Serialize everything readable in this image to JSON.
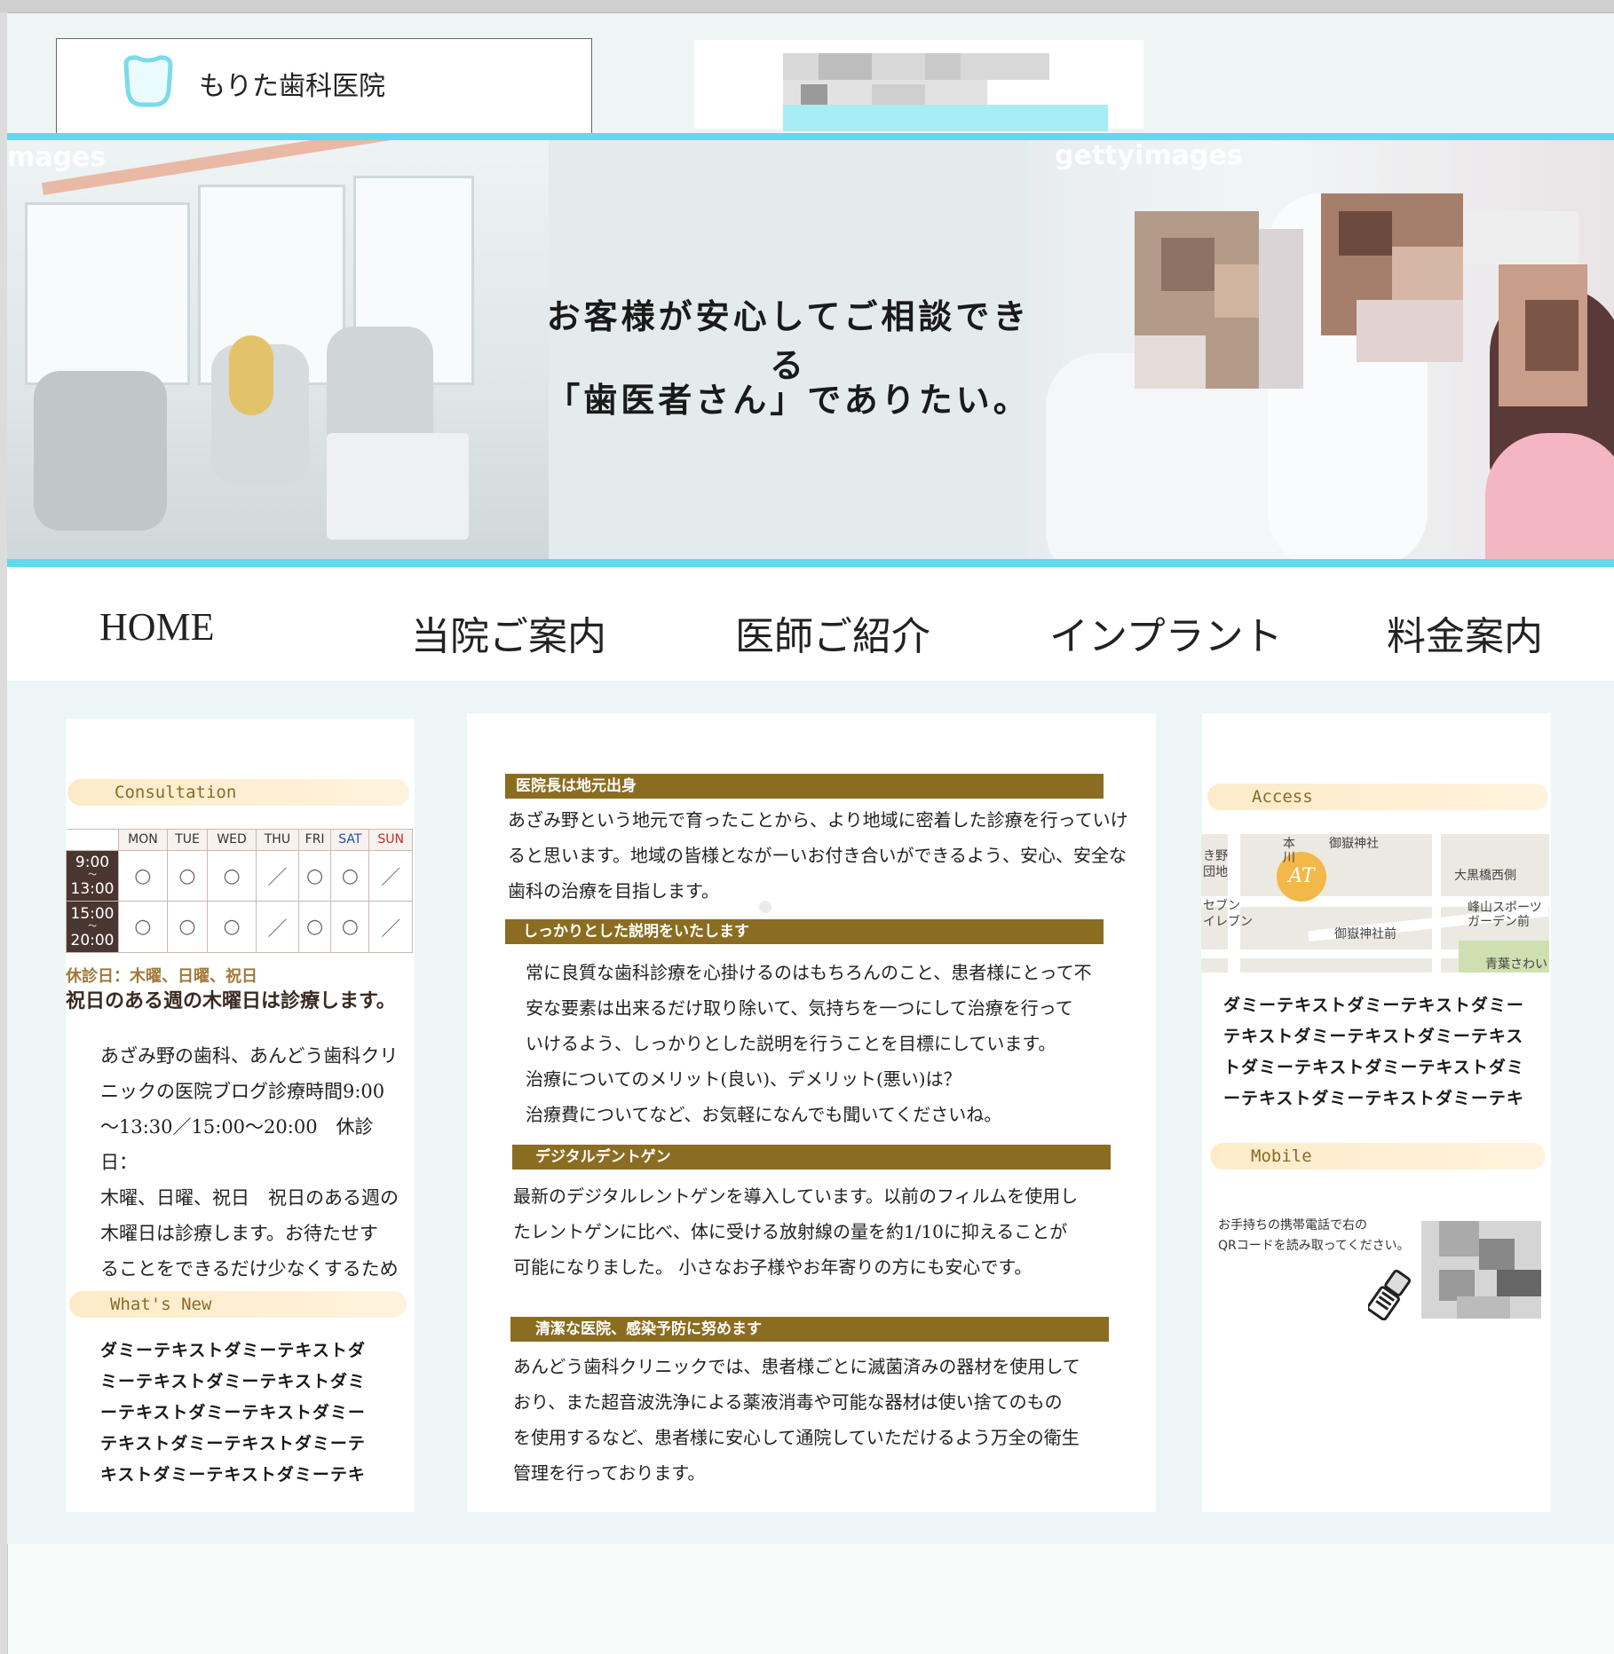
{
  "site": {
    "name": "もりた歯科医院"
  },
  "hero": {
    "line1": "お客様が安心してご相談できる",
    "line2": "「歯医者さん」でありたい。",
    "watermark_left": "mages",
    "watermark_right": "gettyimages"
  },
  "nav": {
    "items": [
      "HOME",
      "当院ご案内",
      "医師ご紹介",
      "インプラント",
      "料金案内"
    ]
  },
  "left": {
    "consultation_label": "Consultation",
    "schedule": {
      "days": [
        "MON",
        "TUE",
        "WED",
        "THU",
        "FRI",
        "SAT",
        "SUN"
      ],
      "rows": [
        {
          "time_start": "9:00",
          "time_end": "13:00",
          "marks": [
            "○",
            "○",
            "○",
            "／",
            "○",
            "○",
            "／"
          ]
        },
        {
          "time_start": "15:00",
          "time_end": "20:00",
          "marks": [
            "○",
            "○",
            "○",
            "／",
            "○",
            "○",
            "／"
          ]
        }
      ],
      "time_sep": "～"
    },
    "closed_label": "休診日：木曜、日曜、祝日",
    "closed_note": "祝日のある週の木曜日は診療します。",
    "para_lines": [
      "あざみ野の歯科、あんどう歯科クリ",
      "ニックの医院ブログ診療時間9:00",
      "～13:30／15:00～20:00　休診日：",
      "木曜、日曜、祝日　祝日のある週の",
      "木曜日は診療します。お待たせす",
      "ることをできるだけ少なくするために"
    ],
    "whats_new_label": "What's New",
    "whats_new_lines": [
      "ダミーテキストダミーテキストダ",
      "ミーテキストダミーテキストダミ",
      "ーテキストダミーテキストダミー",
      "テキストダミーテキストダミーテ",
      "キストダミーテキストダミーテキ"
    ]
  },
  "middle": {
    "sections": [
      {
        "heading": "医院長は地元出身",
        "lines": [
          "あざみ野という地元で育ったことから、より地域に密着した診療を行っていけ",
          "ると思います。地域の皆様とながーいお付き合いができるよう、安心、安全な",
          "歯科の治療を目指します。"
        ]
      },
      {
        "heading": "しっかりとした説明をいたします",
        "lines": [
          "常に良質な歯科診療を心掛けるのはもちろんのこと、患者様にとって不",
          "安な要素は出来るだけ取り除いて、気持ちを一つにして治療を行って",
          "いけるよう、しっかりとした説明を行うことを目標にしています。",
          "治療についてのメリット(良い)、デメリット(悪い)は？",
          "治療費についてなど、お気軽になんでも聞いてくださいね。"
        ]
      },
      {
        "heading": "デジタルデントゲン",
        "lines": [
          "最新のデジタルレントゲンを導入しています。以前のフィルムを使用し",
          "たレントゲンに比べ、体に受ける放射線の量を約1/10に抑えることが",
          "可能になりました。 小さなお子様やお年寄りの方にも安心です。"
        ]
      },
      {
        "heading": "清潔な医院、感染予防に努めます",
        "lines": [
          "あんどう歯科クリニックでは、患者様ごとに滅菌済みの器材を使用して",
          "おり、また超音波洗浄による薬液消毒や可能な器材は使い捨てのもの",
          "を使用するなど、患者様に安心して通院していただけるよう万全の衛生",
          "管理を行っております。"
        ]
      }
    ]
  },
  "right": {
    "access_label": "Access",
    "map_labels": [
      "御嶽神社",
      "大黒橋西側",
      "峰山スポーツ",
      "ガーデン前",
      "御嶽神社前",
      "青葉さわい",
      "セブン",
      "イレブン",
      "き野",
      "団地",
      "本",
      "川"
    ],
    "map_pin": "AT",
    "access_lines": [
      "ダミーテキストダミーテキストダミー",
      "テキストダミーテキストダミーテキス",
      "トダミーテキストダミーテキストダミ",
      "ーテキストダミーテキストダミーテキ"
    ],
    "mobile_label": "Mobile",
    "qr_text_lines": [
      "お手持ちの携帯電話で右の",
      "QRコードを読み取ってください。"
    ]
  },
  "colors": {
    "accent_cyan": "#5fd9ee",
    "section_brown": "#8b6d22",
    "pill_cream": "#fdebc8",
    "page_bg": "#ecf6f6"
  },
  "icons": {
    "logo": "tooth-icon",
    "phone": "mobile-phone-icon"
  }
}
